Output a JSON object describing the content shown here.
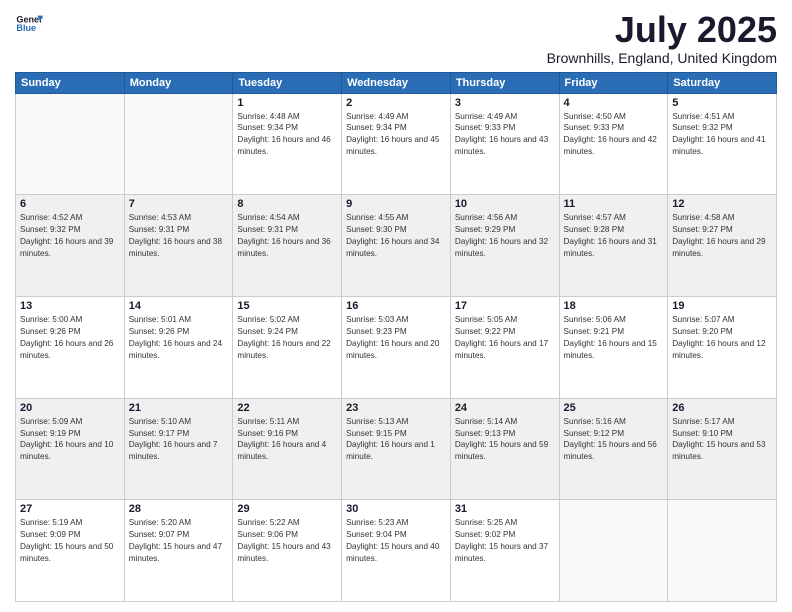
{
  "header": {
    "logo_line1": "General",
    "logo_line2": "Blue",
    "month_year": "July 2025",
    "location": "Brownhills, England, United Kingdom"
  },
  "days_of_week": [
    "Sunday",
    "Monday",
    "Tuesday",
    "Wednesday",
    "Thursday",
    "Friday",
    "Saturday"
  ],
  "weeks": [
    [
      {
        "day": "",
        "empty": true
      },
      {
        "day": "",
        "empty": true
      },
      {
        "day": "1",
        "sunrise": "4:48 AM",
        "sunset": "9:34 PM",
        "daylight": "16 hours and 46 minutes."
      },
      {
        "day": "2",
        "sunrise": "4:49 AM",
        "sunset": "9:34 PM",
        "daylight": "16 hours and 45 minutes."
      },
      {
        "day": "3",
        "sunrise": "4:49 AM",
        "sunset": "9:33 PM",
        "daylight": "16 hours and 43 minutes."
      },
      {
        "day": "4",
        "sunrise": "4:50 AM",
        "sunset": "9:33 PM",
        "daylight": "16 hours and 42 minutes."
      },
      {
        "day": "5",
        "sunrise": "4:51 AM",
        "sunset": "9:32 PM",
        "daylight": "16 hours and 41 minutes."
      }
    ],
    [
      {
        "day": "6",
        "sunrise": "4:52 AM",
        "sunset": "9:32 PM",
        "daylight": "16 hours and 39 minutes."
      },
      {
        "day": "7",
        "sunrise": "4:53 AM",
        "sunset": "9:31 PM",
        "daylight": "16 hours and 38 minutes."
      },
      {
        "day": "8",
        "sunrise": "4:54 AM",
        "sunset": "9:31 PM",
        "daylight": "16 hours and 36 minutes."
      },
      {
        "day": "9",
        "sunrise": "4:55 AM",
        "sunset": "9:30 PM",
        "daylight": "16 hours and 34 minutes."
      },
      {
        "day": "10",
        "sunrise": "4:56 AM",
        "sunset": "9:29 PM",
        "daylight": "16 hours and 32 minutes."
      },
      {
        "day": "11",
        "sunrise": "4:57 AM",
        "sunset": "9:28 PM",
        "daylight": "16 hours and 31 minutes."
      },
      {
        "day": "12",
        "sunrise": "4:58 AM",
        "sunset": "9:27 PM",
        "daylight": "16 hours and 29 minutes."
      }
    ],
    [
      {
        "day": "13",
        "sunrise": "5:00 AM",
        "sunset": "9:26 PM",
        "daylight": "16 hours and 26 minutes."
      },
      {
        "day": "14",
        "sunrise": "5:01 AM",
        "sunset": "9:26 PM",
        "daylight": "16 hours and 24 minutes."
      },
      {
        "day": "15",
        "sunrise": "5:02 AM",
        "sunset": "9:24 PM",
        "daylight": "16 hours and 22 minutes."
      },
      {
        "day": "16",
        "sunrise": "5:03 AM",
        "sunset": "9:23 PM",
        "daylight": "16 hours and 20 minutes."
      },
      {
        "day": "17",
        "sunrise": "5:05 AM",
        "sunset": "9:22 PM",
        "daylight": "16 hours and 17 minutes."
      },
      {
        "day": "18",
        "sunrise": "5:06 AM",
        "sunset": "9:21 PM",
        "daylight": "16 hours and 15 minutes."
      },
      {
        "day": "19",
        "sunrise": "5:07 AM",
        "sunset": "9:20 PM",
        "daylight": "16 hours and 12 minutes."
      }
    ],
    [
      {
        "day": "20",
        "sunrise": "5:09 AM",
        "sunset": "9:19 PM",
        "daylight": "16 hours and 10 minutes."
      },
      {
        "day": "21",
        "sunrise": "5:10 AM",
        "sunset": "9:17 PM",
        "daylight": "16 hours and 7 minutes."
      },
      {
        "day": "22",
        "sunrise": "5:11 AM",
        "sunset": "9:16 PM",
        "daylight": "16 hours and 4 minutes."
      },
      {
        "day": "23",
        "sunrise": "5:13 AM",
        "sunset": "9:15 PM",
        "daylight": "16 hours and 1 minute."
      },
      {
        "day": "24",
        "sunrise": "5:14 AM",
        "sunset": "9:13 PM",
        "daylight": "15 hours and 59 minutes."
      },
      {
        "day": "25",
        "sunrise": "5:16 AM",
        "sunset": "9:12 PM",
        "daylight": "15 hours and 56 minutes."
      },
      {
        "day": "26",
        "sunrise": "5:17 AM",
        "sunset": "9:10 PM",
        "daylight": "15 hours and 53 minutes."
      }
    ],
    [
      {
        "day": "27",
        "sunrise": "5:19 AM",
        "sunset": "9:09 PM",
        "daylight": "15 hours and 50 minutes."
      },
      {
        "day": "28",
        "sunrise": "5:20 AM",
        "sunset": "9:07 PM",
        "daylight": "15 hours and 47 minutes."
      },
      {
        "day": "29",
        "sunrise": "5:22 AM",
        "sunset": "9:06 PM",
        "daylight": "15 hours and 43 minutes."
      },
      {
        "day": "30",
        "sunrise": "5:23 AM",
        "sunset": "9:04 PM",
        "daylight": "15 hours and 40 minutes."
      },
      {
        "day": "31",
        "sunrise": "5:25 AM",
        "sunset": "9:02 PM",
        "daylight": "15 hours and 37 minutes."
      },
      {
        "day": "",
        "empty": true
      },
      {
        "day": "",
        "empty": true
      }
    ]
  ]
}
